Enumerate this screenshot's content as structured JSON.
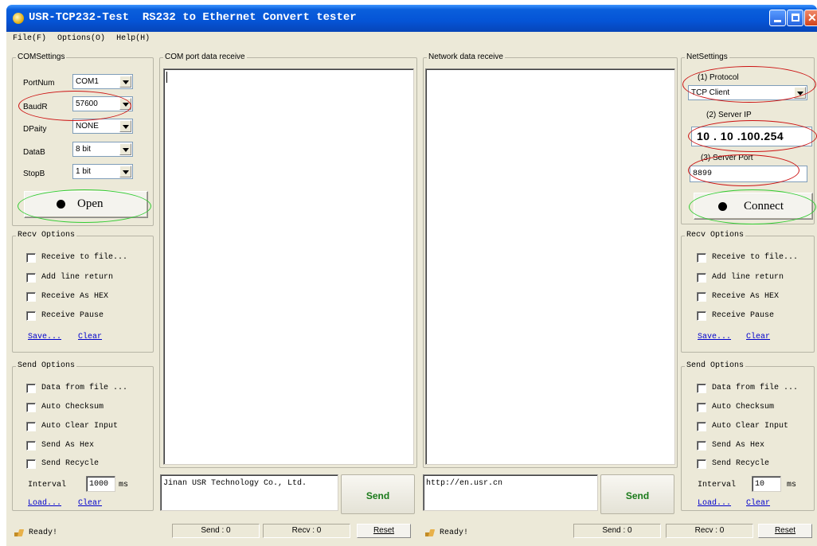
{
  "window": {
    "title": "USR-TCP232-Test  RS232 to Ethernet Convert tester"
  },
  "menu": [
    "File(F)",
    "Options(O)",
    "Help(H)"
  ],
  "com_settings": {
    "legend": "COMSettings",
    "port_num": {
      "label": "PortNum",
      "value": "COM1"
    },
    "baud_rate": {
      "label": "BaudR",
      "value": "57600"
    },
    "parity": {
      "label": "DPaity",
      "value": "NONE"
    },
    "data_bits": {
      "label": "DataB",
      "value": "8 bit"
    },
    "stop_bits": {
      "label": "StopB",
      "value": "1 bit"
    },
    "open_button": "Open"
  },
  "com_receive": {
    "legend": "COM port data receive"
  },
  "net_receive": {
    "legend": "Network data receive"
  },
  "net_settings": {
    "legend": "NetSettings",
    "protocol_label": "(1) Protocol",
    "protocol_value": "TCP Client",
    "server_ip_label": "(2) Server IP",
    "server_ip_value": "10 . 10 .100.254",
    "server_port_label": "(3) Server Port",
    "server_port_value": "8899",
    "connect_button": "Connect"
  },
  "recv_options": {
    "legend": "Recv Options",
    "items": [
      "Receive to file...",
      "Add line return",
      "Receive As HEX",
      "Receive Pause"
    ],
    "save_link": "Save...",
    "clear_link": "Clear"
  },
  "send_options": {
    "legend": "Send Options",
    "items": [
      "Data from file ...",
      "Auto Checksum",
      "Auto Clear Input",
      "Send As Hex",
      "Send Recycle"
    ],
    "interval_label": "Interval",
    "load_link": "Load...",
    "clear_link": "Clear",
    "unit": "ms"
  },
  "left_send_options": {
    "interval_value": "1000"
  },
  "right_send_options": {
    "interval_value": "10"
  },
  "com_send": {
    "text": "Jinan USR Technology Co., Ltd.",
    "button": "Send"
  },
  "net_send": {
    "text": "http://en.usr.cn",
    "button": "Send"
  },
  "status": {
    "ready": "Ready!",
    "send_count": "Send : 0",
    "recv_count": "Recv : 0",
    "reset": "Reset"
  },
  "colors": {
    "title_bar": "#0554d6",
    "window_bg": "#ece9d8",
    "send_text": "#1a7a1a",
    "annotation_red": "#cc1111",
    "annotation_green": "#33cc33"
  }
}
